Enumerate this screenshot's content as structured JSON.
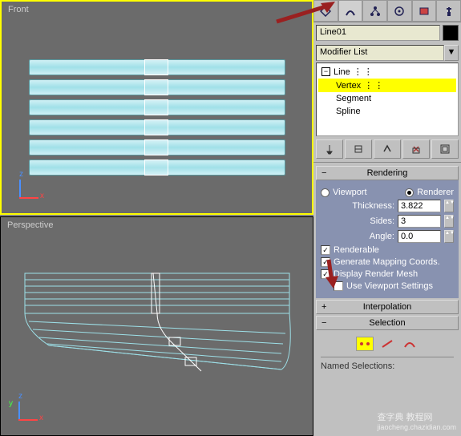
{
  "viewports": {
    "front_label": "Front",
    "perspective_label": "Perspective"
  },
  "object_name": "Line01",
  "modifier_list_label": "Modifier List",
  "stack": {
    "root": "Line",
    "sub": [
      "Vertex",
      "Segment",
      "Spline"
    ],
    "selected_index": 0
  },
  "rendering": {
    "title": "Rendering",
    "viewport_label": "Viewport",
    "renderer_label": "Renderer",
    "renderer_selected": true,
    "thickness_label": "Thickness:",
    "thickness_value": "3.822",
    "sides_label": "Sides:",
    "sides_value": "3",
    "angle_label": "Angle:",
    "angle_value": "0.0",
    "renderable_label": "Renderable",
    "renderable_checked": true,
    "mapping_label": "Generate Mapping Coords.",
    "mapping_checked": true,
    "display_mesh_label": "Display Render Mesh",
    "display_mesh_checked": true,
    "use_viewport_label": "Use Viewport Settings",
    "use_viewport_checked": false
  },
  "interpolation_title": "Interpolation",
  "selection": {
    "title": "Selection",
    "named_label": "Named Selections:"
  },
  "watermark": "查字典 教程网",
  "watermark_url": "jiaocheng.chazidian.com"
}
